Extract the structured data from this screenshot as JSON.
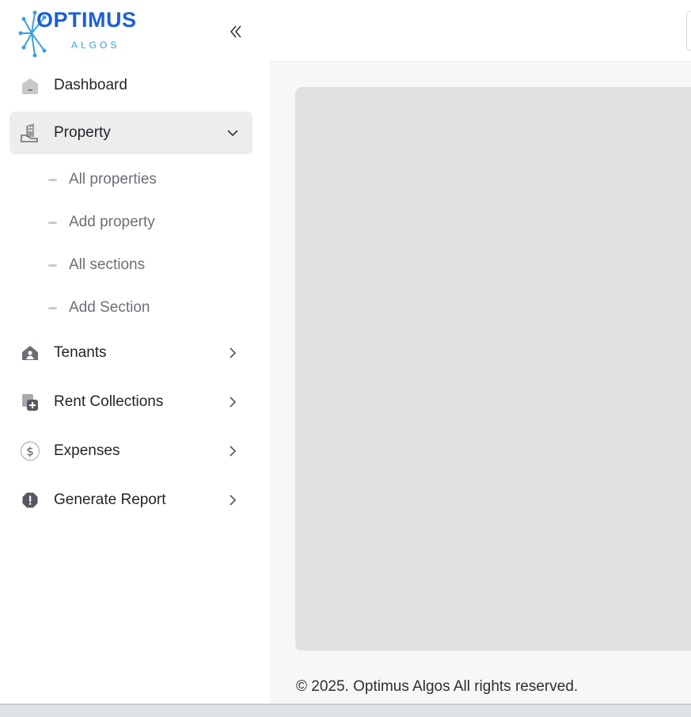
{
  "brand": {
    "name": "OPTIMUS",
    "tagline": "ALGOS",
    "primary_color": "#1c5fd6",
    "accent_color": "#3aa0e0"
  },
  "sidebar": {
    "collapse_icon": "double-chevron-left-icon",
    "items": [
      {
        "label": "Dashboard",
        "icon": "home-icon"
      },
      {
        "label": "Property",
        "icon": "building-icon",
        "expanded": true,
        "children": [
          {
            "label": "All properties"
          },
          {
            "label": "Add property"
          },
          {
            "label": "All sections"
          },
          {
            "label": "Add Section"
          }
        ]
      },
      {
        "label": "Tenants",
        "icon": "tenant-house-icon"
      },
      {
        "label": "Rent Collections",
        "icon": "rent-collection-icon"
      },
      {
        "label": "Expenses",
        "icon": "dollar-icon"
      },
      {
        "label": "Generate Report",
        "icon": "report-alert-icon"
      }
    ]
  },
  "footer": {
    "copyright": "© 2025. Optimus Algos All rights reserved."
  }
}
